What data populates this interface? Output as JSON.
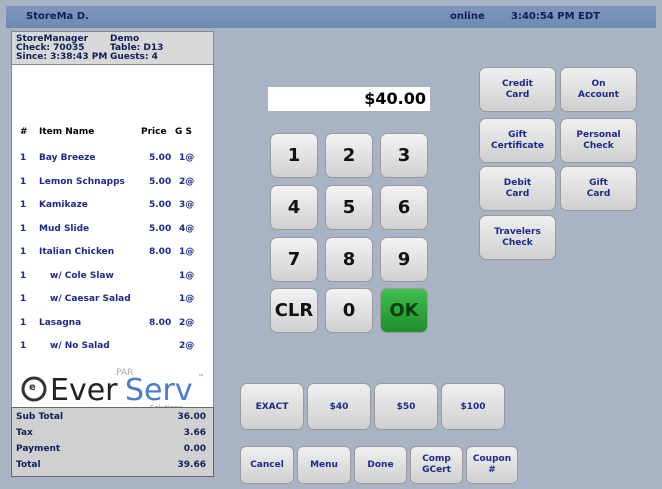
{
  "header": {
    "user": "StoreMa D.",
    "status": "online",
    "time": "3:40:54 PM EDT"
  },
  "order": {
    "manager": "StoreManager",
    "check": "Check: 70035",
    "since": "Since: 3:38:43 PM",
    "mode": "Demo",
    "table": "Table: D13",
    "guests": "Guests: 4"
  },
  "columns": {
    "num": "#",
    "name": "Item Name",
    "price": "Price",
    "gs": "G S"
  },
  "items": [
    {
      "qty": "1",
      "name": "Bay Breeze",
      "price": "5.00",
      "gs": "1@"
    },
    {
      "qty": "1",
      "name": "Lemon Schnapps",
      "price": "5.00",
      "gs": "2@"
    },
    {
      "qty": "1",
      "name": "Kamikaze",
      "price": "5.00",
      "gs": "3@"
    },
    {
      "qty": "1",
      "name": "Mud Slide",
      "price": "5.00",
      "gs": "4@"
    },
    {
      "qty": "1",
      "name": "Italian Chicken",
      "price": "8.00",
      "gs": "1@"
    },
    {
      "qty": "1",
      "name": "w/ Cole Slaw",
      "price": "",
      "gs": "1@"
    },
    {
      "qty": "1",
      "name": "w/ Caesar Salad",
      "price": "",
      "gs": "1@"
    },
    {
      "qty": "1",
      "name": "Lasagna",
      "price": "8.00",
      "gs": "2@"
    },
    {
      "qty": "1",
      "name": "w/ No Salad",
      "price": "",
      "gs": "2@"
    }
  ],
  "logo": {
    "text": "EverServ",
    "par": "PAR",
    "sub": "Solutions",
    "tm": "™"
  },
  "totals": [
    {
      "label": "Sub Total",
      "value": "36.00"
    },
    {
      "label": "Tax",
      "value": "3.66"
    },
    {
      "label": "Payment",
      "value": "0.00"
    },
    {
      "label": "Total",
      "value": "39.66"
    }
  ],
  "amount": "$40.00",
  "keypad": [
    "1",
    "2",
    "3",
    "4",
    "5",
    "6",
    "7",
    "8",
    "9",
    "CLR",
    "0",
    "OK"
  ],
  "payments": [
    "Credit\nCard",
    "On\nAccount",
    "Gift\nCertificate",
    "Personal\nCheck",
    "Debit\nCard",
    "Gift\nCard",
    "Travelers\nCheck"
  ],
  "quick": [
    "EXACT",
    "$40",
    "$50",
    "$100"
  ],
  "bottom": [
    "Cancel",
    "Menu",
    "Done",
    "Comp\nGCert",
    "Coupon\n#"
  ],
  "colors": {
    "ok": "#2aa23a",
    "text_blue": "#1b2a8c",
    "background": "#a8b3c4"
  }
}
